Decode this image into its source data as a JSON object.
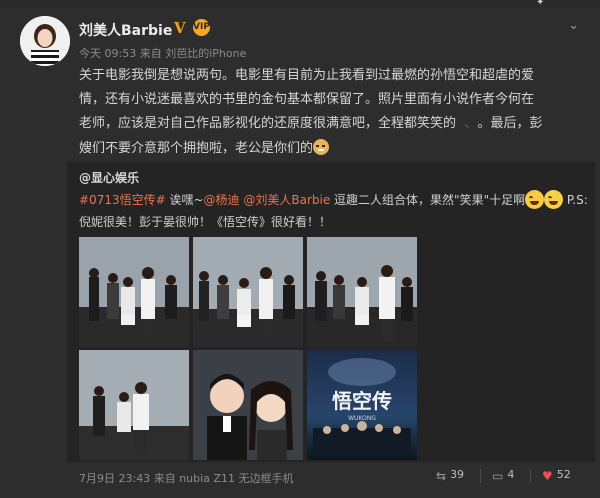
{
  "post": {
    "username": "刘美人Barbie",
    "verified_badge": "V",
    "vip_badge": "VIP",
    "meta_time": "今天 09:53",
    "meta_from": "来自",
    "meta_source": "刘芭比的iPhone",
    "text_line1": "关于电影我倒是想说两句。电影里有目前为止我看到过最燃的孙悟空和超虐的爱",
    "text_line2": "情，还有小说迷最喜欢的书里的金句基本都保留了。照片里面有小说作者今何在",
    "text_line3": "老师，应该是对自己作品影视化的还原度很满意吧，全程都笑笑的",
    "text_line3b": "。最后，彭",
    "text_line4": "嫂们不要介意那个拥抱啦，老公是你们的"
  },
  "repost": {
    "author": "@显心娱乐",
    "topic": "#0713悟空传#",
    "text_a": " 诶嘿~",
    "mention1": "@杨迪",
    "mention2": "@刘美人Barbie",
    "text_b": " 逗趣二人组合体，果然\"笑果\"十足啊",
    "text_c": " P.S:",
    "text_line2": "倪妮很美！彭于晏很帅！《悟空传》很好看！！",
    "poster_title": "悟空传",
    "poster_subtitle": "WUKONG",
    "footer_time": "7月9日 23:43",
    "footer_from": "来自",
    "footer_device": "nubia Z11 无边框手机",
    "reposts": "39",
    "comments": "4",
    "likes": "52"
  },
  "icons": {
    "chevron": "chevron-down-icon",
    "repost": "repost-icon",
    "comment": "comment-icon",
    "like": "like-icon"
  },
  "colors": {
    "accent_link": "#eb7350",
    "verified": "#f2a21c",
    "background": "#2d2d2d"
  }
}
